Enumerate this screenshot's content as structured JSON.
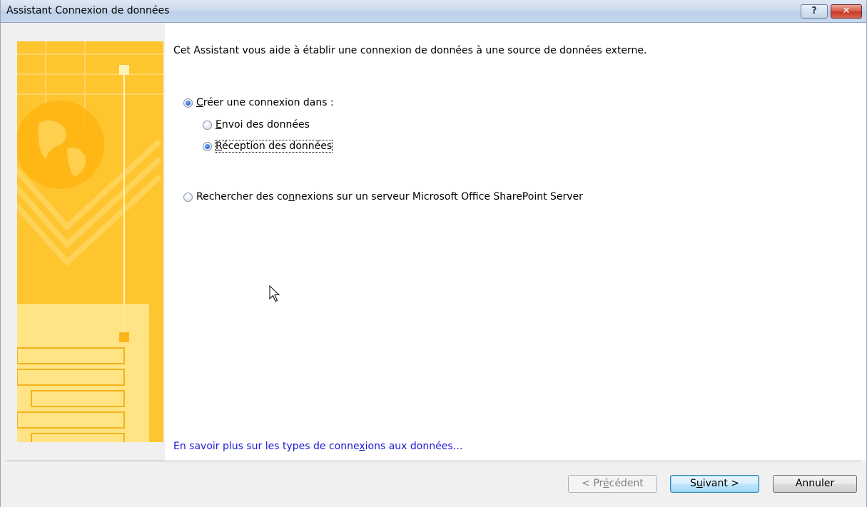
{
  "window": {
    "title": "Assistant Connexion de données",
    "help_label": "?",
    "close_label": "✕"
  },
  "intro_text": "Cet Assistant vous aide à établir une connexion de données à une source de données externe.",
  "options": {
    "create": {
      "prefix": "",
      "accel": "C",
      "rest": "réer une connexion dans :",
      "checked": true
    },
    "send": {
      "prefix": "",
      "accel": "E",
      "rest": "nvoi des données",
      "checked": false
    },
    "receive": {
      "prefix": "",
      "accel": "R",
      "rest": "éception des données",
      "checked": true
    },
    "sharepoint": {
      "prefix": "Rechercher des co",
      "accel": "n",
      "rest": "nexions sur un serveur Microsoft Office SharePoint Server",
      "checked": false
    }
  },
  "learn_more_link": {
    "prefix": "En savoir plus sur les types de conne",
    "accel": "x",
    "rest": "ions aux données…"
  },
  "buttons": {
    "previous": {
      "prefix": "< Pr",
      "accel": "é",
      "rest": "cédent",
      "enabled": false
    },
    "next": {
      "prefix": "S",
      "accel": "u",
      "rest": "ivant >",
      "enabled": true
    },
    "cancel": {
      "label": "Annuler"
    }
  },
  "colors": {
    "banner": "#ffc32a",
    "link": "#1a1ad6",
    "radio_selected": "#1a5fcf"
  }
}
